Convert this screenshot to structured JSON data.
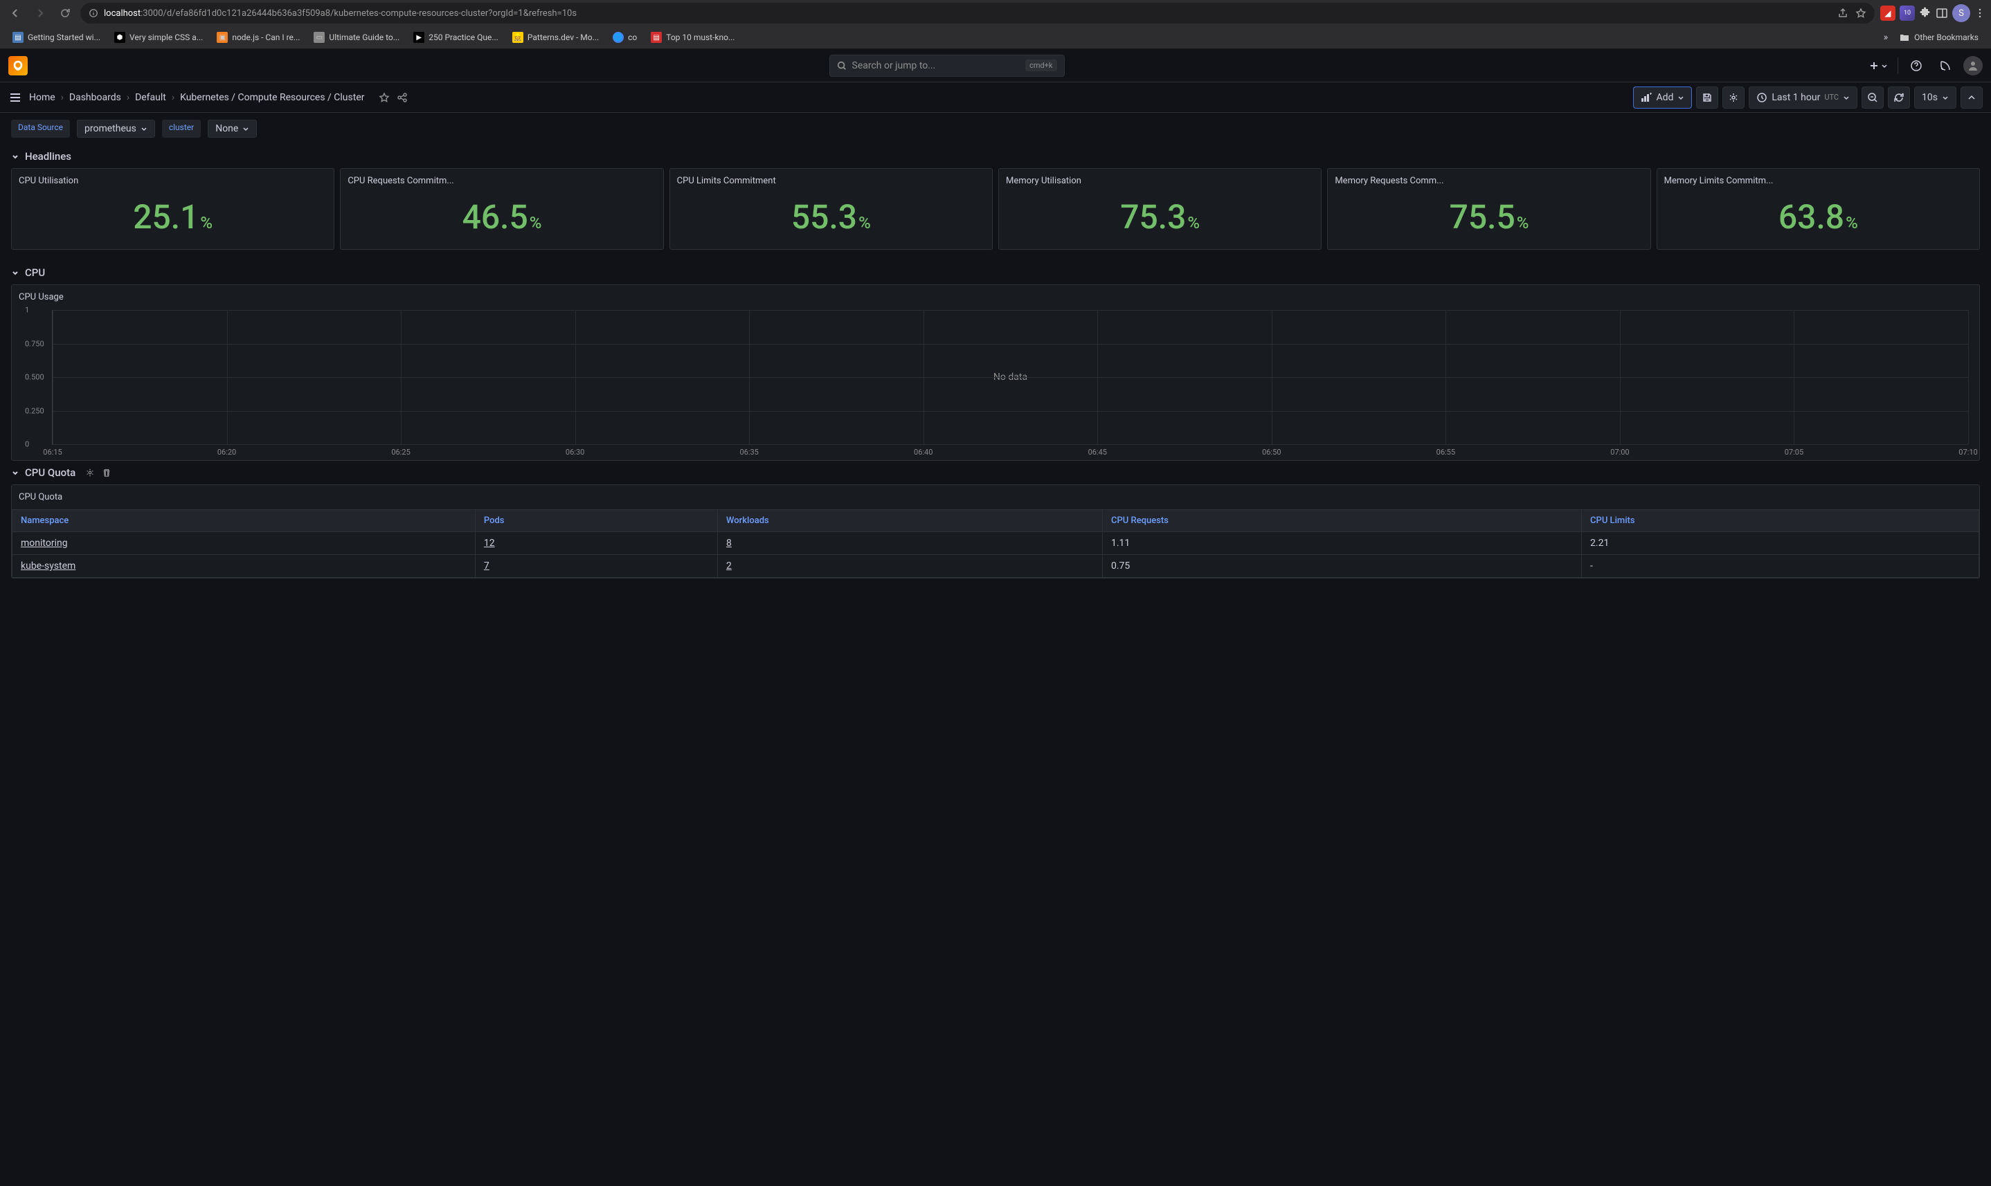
{
  "browser": {
    "url_host": "localhost",
    "url_path": ":3000/d/efa86fd1d0c121a26444b636a3f509a8/kubernetes-compute-resources-cluster?orgId=1&refresh=10s",
    "ext_badge": "10",
    "avatar_letter": "S",
    "bookmarks": [
      "Getting Started wi...",
      "Very simple CSS a...",
      "node.js - Can I re...",
      "Ultimate Guide to...",
      "250 Practice Que...",
      "Patterns.dev - Mo...",
      "co",
      "Top 10 must-kno..."
    ],
    "other_bookmarks": "Other Bookmarks",
    "chevron": "»"
  },
  "header": {
    "search_placeholder": "Search or jump to...",
    "kbd": "cmd+k"
  },
  "nav": {
    "crumbs": [
      "Home",
      "Dashboards",
      "Default",
      "Kubernetes / Compute Resources / Cluster"
    ],
    "add": "Add",
    "time_range": "Last 1 hour",
    "utc": "UTC",
    "refresh_interval": "10s"
  },
  "vars": {
    "ds_label": "Data Source",
    "ds_value": "prometheus",
    "cluster_label": "cluster",
    "cluster_value": "None"
  },
  "sections": {
    "headlines": "Headlines",
    "cpu": "CPU",
    "cpu_quota": "CPU Quota"
  },
  "stats": [
    {
      "title": "CPU Utilisation",
      "value": "25.1"
    },
    {
      "title": "CPU Requests Commitm...",
      "value": "46.5"
    },
    {
      "title": "CPU Limits Commitment",
      "value": "55.3"
    },
    {
      "title": "Memory Utilisation",
      "value": "75.3"
    },
    {
      "title": "Memory Requests Comm...",
      "value": "75.5"
    },
    {
      "title": "Memory Limits Commitm...",
      "value": "63.8"
    }
  ],
  "cpu_usage": {
    "title": "CPU Usage",
    "no_data": "No data"
  },
  "chart_data": {
    "type": "line",
    "title": "CPU Usage",
    "y_ticks": [
      "0",
      "0.250",
      "0.500",
      "0.750",
      "1"
    ],
    "x_ticks": [
      "06:15",
      "06:20",
      "06:25",
      "06:30",
      "06:35",
      "06:40",
      "06:45",
      "06:50",
      "06:55",
      "07:00",
      "07:05",
      "07:10"
    ],
    "ylim": [
      0,
      1
    ],
    "series": [],
    "note": "No data"
  },
  "quota": {
    "title": "CPU Quota",
    "columns": [
      "Namespace",
      "Pods",
      "Workloads",
      "CPU Requests",
      "CPU Limits"
    ],
    "rows": [
      {
        "ns": "monitoring",
        "pods": "12",
        "workloads": "8",
        "req": "1.11",
        "lim": "2.21"
      },
      {
        "ns": "kube-system",
        "pods": "7",
        "workloads": "2",
        "req": "0.75",
        "lim": "-"
      }
    ]
  }
}
